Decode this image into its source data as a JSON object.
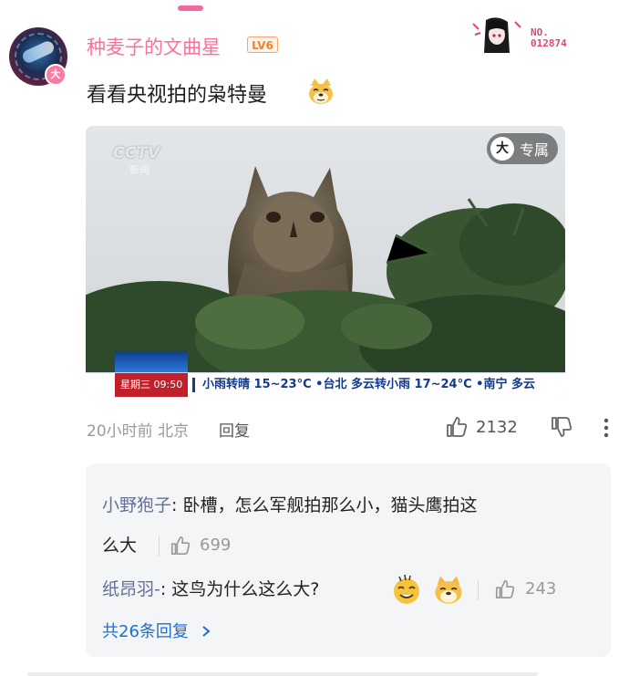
{
  "comment": {
    "username": "种麦子的文曲星",
    "level": "LV6",
    "fan_no_prefix": "NO.",
    "fan_no": "012874",
    "avatar_badge": "大",
    "text": "看看央视拍的枭特曼",
    "time": "20小时前",
    "location": "北京",
    "reply_label": "回复",
    "likes": "2132"
  },
  "video": {
    "logo": "CCTV",
    "logo_sub": "新闻",
    "exclusive_icon": "大",
    "exclusive_label": "专属",
    "ticker_day": "星期三  09:50",
    "ticker_text": "小雨转晴 15~23°C  •台北 多云转小雨 17~24°C  •南宁 多云"
  },
  "replies": [
    {
      "name": "小野狍子",
      "text_line1": ": 卧槽，怎么军舰拍那么小，猫头鹰拍这",
      "text_line2": "么大",
      "likes": "699"
    },
    {
      "name": "纸昂羽-",
      "text": ": 这鸟为什么这么大?",
      "likes": "243",
      "emojis": [
        "sweat-smile-emoji",
        "doge-emoji"
      ]
    }
  ],
  "all_replies": "共26条回复",
  "icons": [
    "thumb-up-icon",
    "thumb-down-icon",
    "more-vertical-icon",
    "chevron-right-icon"
  ],
  "colors": {
    "username": "#fb7299",
    "reply_name": "#617198",
    "link": "#1e6fd0",
    "level": "#f6802a"
  }
}
